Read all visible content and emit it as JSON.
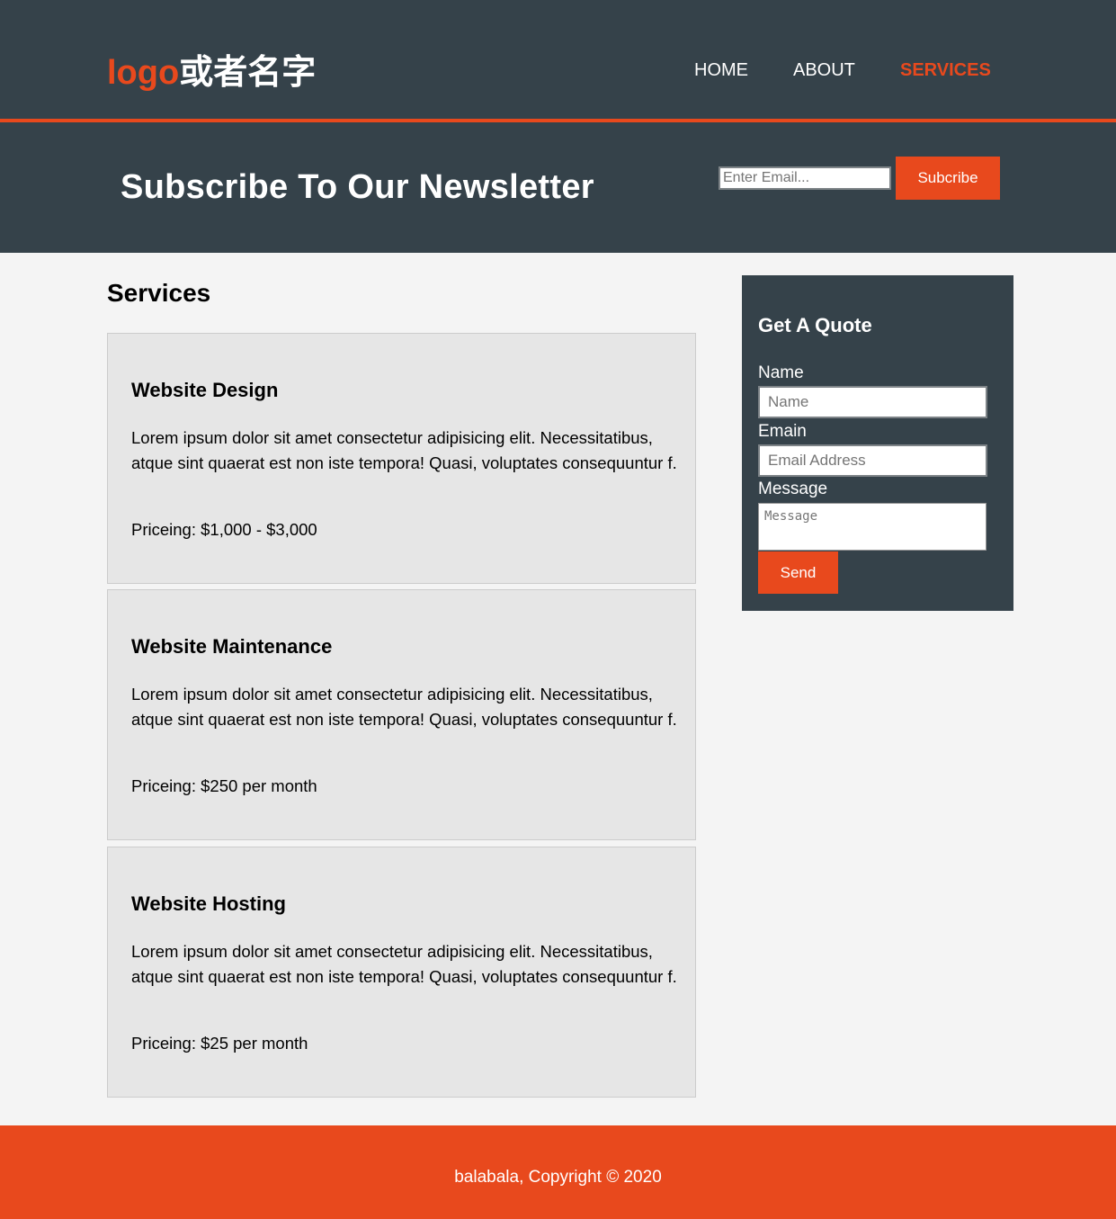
{
  "header": {
    "logo_highlight": "logo",
    "logo_rest": "或者名字",
    "nav": [
      {
        "label": "HOME",
        "active": false
      },
      {
        "label": "ABOUT",
        "active": false
      },
      {
        "label": "SERVICES",
        "active": true
      }
    ]
  },
  "newsletter": {
    "title": "Subscribe To Our Newsletter",
    "email_placeholder": "Enter Email...",
    "button_label": "Subcribe"
  },
  "main": {
    "heading": "Services",
    "services": [
      {
        "title": "Website Design",
        "description": "Lorem ipsum dolor sit amet consectetur adipisicing elit. Necessitatibus, atque sint quaerat est non iste tempora! Quasi, voluptates consequuntur f.",
        "pricing": "Priceing: $1,000 - $3,000"
      },
      {
        "title": "Website Maintenance",
        "description": "Lorem ipsum dolor sit amet consectetur adipisicing elit. Necessitatibus, atque sint quaerat est non iste tempora! Quasi, voluptates consequuntur f.",
        "pricing": "Priceing: $250 per month"
      },
      {
        "title": "Website Hosting",
        "description": "Lorem ipsum dolor sit amet consectetur adipisicing elit. Necessitatibus, atque sint quaerat est non iste tempora! Quasi, voluptates consequuntur f.",
        "pricing": "Priceing: $25 per month"
      }
    ]
  },
  "quote": {
    "title": "Get A Quote",
    "name_label": "Name",
    "name_placeholder": "Name",
    "email_label": "Emain",
    "email_placeholder": "Email Address",
    "message_label": "Message",
    "message_placeholder": "Message",
    "send_label": "Send"
  },
  "footer": {
    "text": "balabala, Copyright © 2020"
  },
  "colors": {
    "dark": "#35424a",
    "accent": "#e8491d",
    "background": "#f4f4f4",
    "card": "#e6e6e6"
  }
}
